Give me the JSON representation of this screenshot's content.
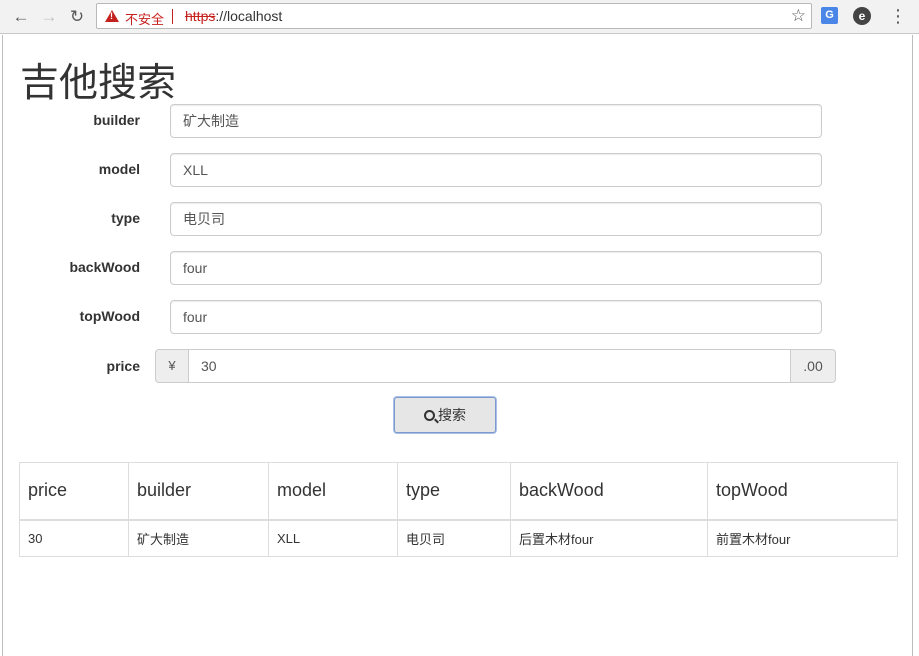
{
  "browser": {
    "security_label": "不安全",
    "url_scheme": "https",
    "url_rest": "://localhost",
    "back_icon": "←",
    "forward_icon": "→",
    "reload_icon": "↻",
    "star_icon": "☆",
    "translate_ext_label": "G",
    "e_ext_label": "e",
    "menu_icon": "⋮"
  },
  "page": {
    "title": "吉他搜索"
  },
  "form": {
    "builder": {
      "label": "builder",
      "value": "矿大制造"
    },
    "model": {
      "label": "model",
      "value": "XLL"
    },
    "type": {
      "label": "type",
      "value": "电贝司"
    },
    "backWood": {
      "label": "backWood",
      "value": "four"
    },
    "topWood": {
      "label": "topWood",
      "value": "four"
    },
    "price": {
      "label": "price",
      "prefix": "¥",
      "value": "30",
      "suffix": ".00"
    },
    "search_button_label": "搜索"
  },
  "table": {
    "headers": [
      "price",
      "builder",
      "model",
      "type",
      "backWood",
      "topWood"
    ],
    "rows": [
      [
        "30",
        "矿大制造",
        "XLL",
        "电贝司",
        "后置木材four",
        "前置木材four"
      ]
    ]
  },
  "colors": {
    "warning_red": "#c5221f",
    "button_border": "#7c9ad0"
  }
}
